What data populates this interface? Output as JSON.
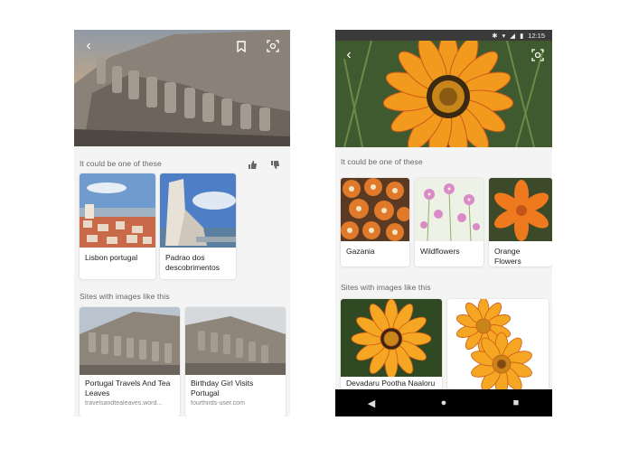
{
  "left": {
    "section1_label": "It could be one of these",
    "matches": [
      {
        "label": "Lisbon portugal"
      },
      {
        "label": "Padrao dos descobrimentos"
      }
    ],
    "section2_label": "Sites with images like this",
    "sites": [
      {
        "title": "Portugal Travels And Tea Leaves",
        "source": "travelsandtealeaves.word..."
      },
      {
        "title": "Birthday Girl Visits Portugal",
        "source": "fourthirds-user.com"
      }
    ],
    "icons": {
      "back": "back-arrow-icon",
      "bookmark": "bookmark-icon",
      "lens": "lens-icon",
      "thumb_up": "thumbs-up-icon",
      "thumb_down": "thumbs-down-icon"
    }
  },
  "right": {
    "status_time": "12:15",
    "section1_label": "It could be one of these",
    "matches": [
      {
        "label": "Gazania"
      },
      {
        "label": "Wildflowers"
      },
      {
        "label": "Orange Flowers"
      }
    ],
    "section2_label": "Sites with images like this",
    "sites": [
      {
        "title": "Devadaru Pootha Naaloru"
      },
      {
        "title": ""
      }
    ]
  },
  "colors": {
    "flower_orange": "#f29a1d",
    "flower_center": "#c8861a",
    "nav_bar": "#000000"
  }
}
